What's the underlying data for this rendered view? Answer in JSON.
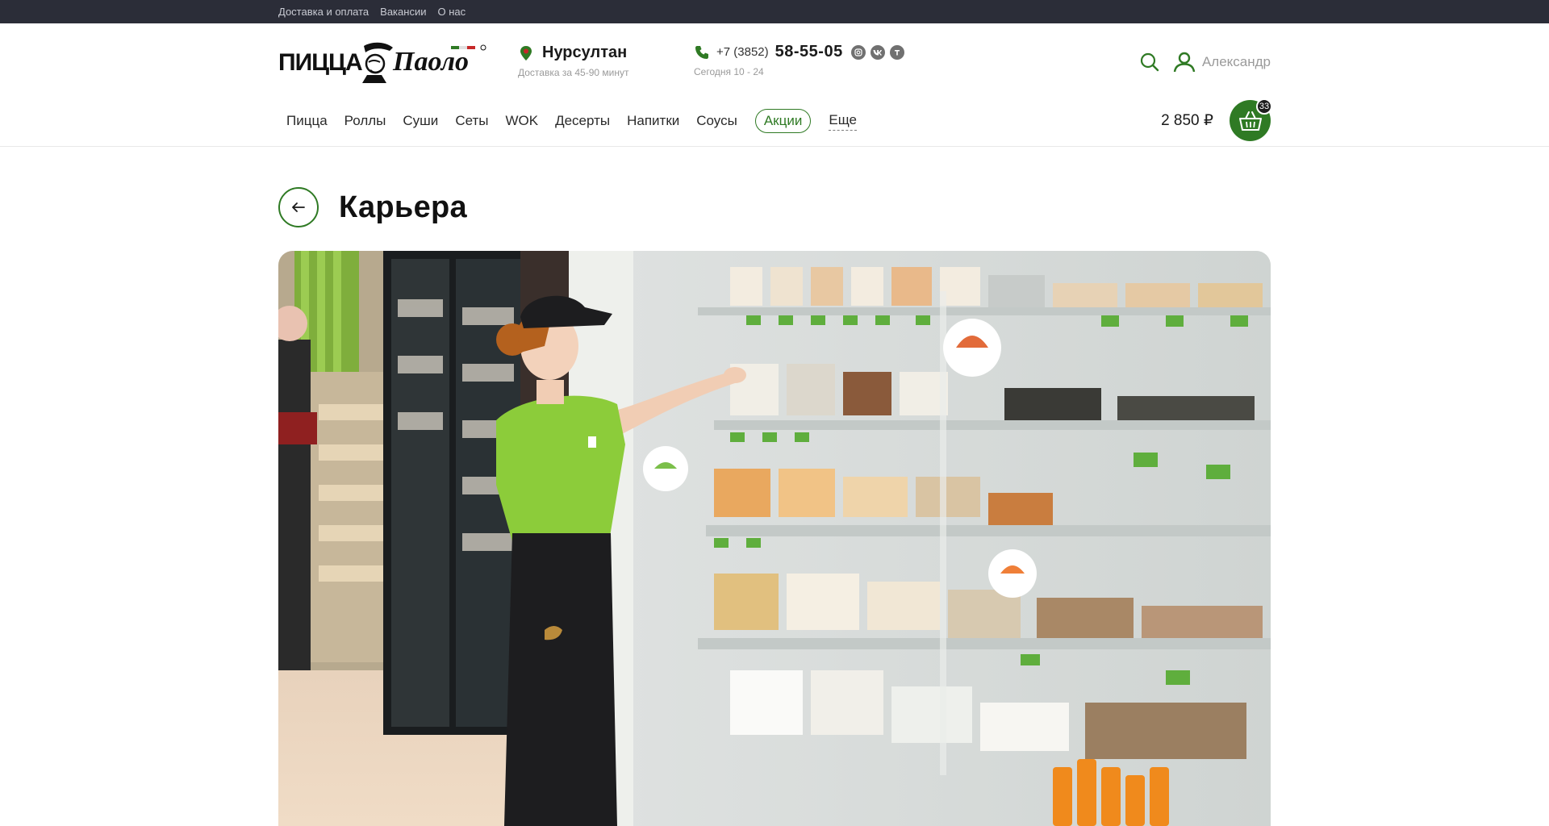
{
  "topbar": {
    "links": [
      "Доставка и оплата",
      "Вакансии",
      "О нас"
    ]
  },
  "header": {
    "logo_text": "Пицца Паоло",
    "city": "Нурсултан",
    "delivery_time": "Доставка за 45-90 минут",
    "phone_prefix": "+7 (3852)",
    "phone_number": "58-55-05",
    "hours": "Сегодня 10 - 24",
    "socials": [
      "instagram-icon",
      "vk-icon",
      "tripadvisor-icon"
    ],
    "user_name": "Александр"
  },
  "nav": {
    "items": [
      "Пицца",
      "Роллы",
      "Суши",
      "Сеты",
      "WOK",
      "Десерты",
      "Напитки",
      "Соусы"
    ],
    "promo": "Акции",
    "more": "Еще"
  },
  "cart": {
    "total": "2 850 ₽",
    "count": "33"
  },
  "page": {
    "title": "Карьера"
  },
  "colors": {
    "accent": "#2f7a24",
    "topbar": "#2b2d38"
  }
}
